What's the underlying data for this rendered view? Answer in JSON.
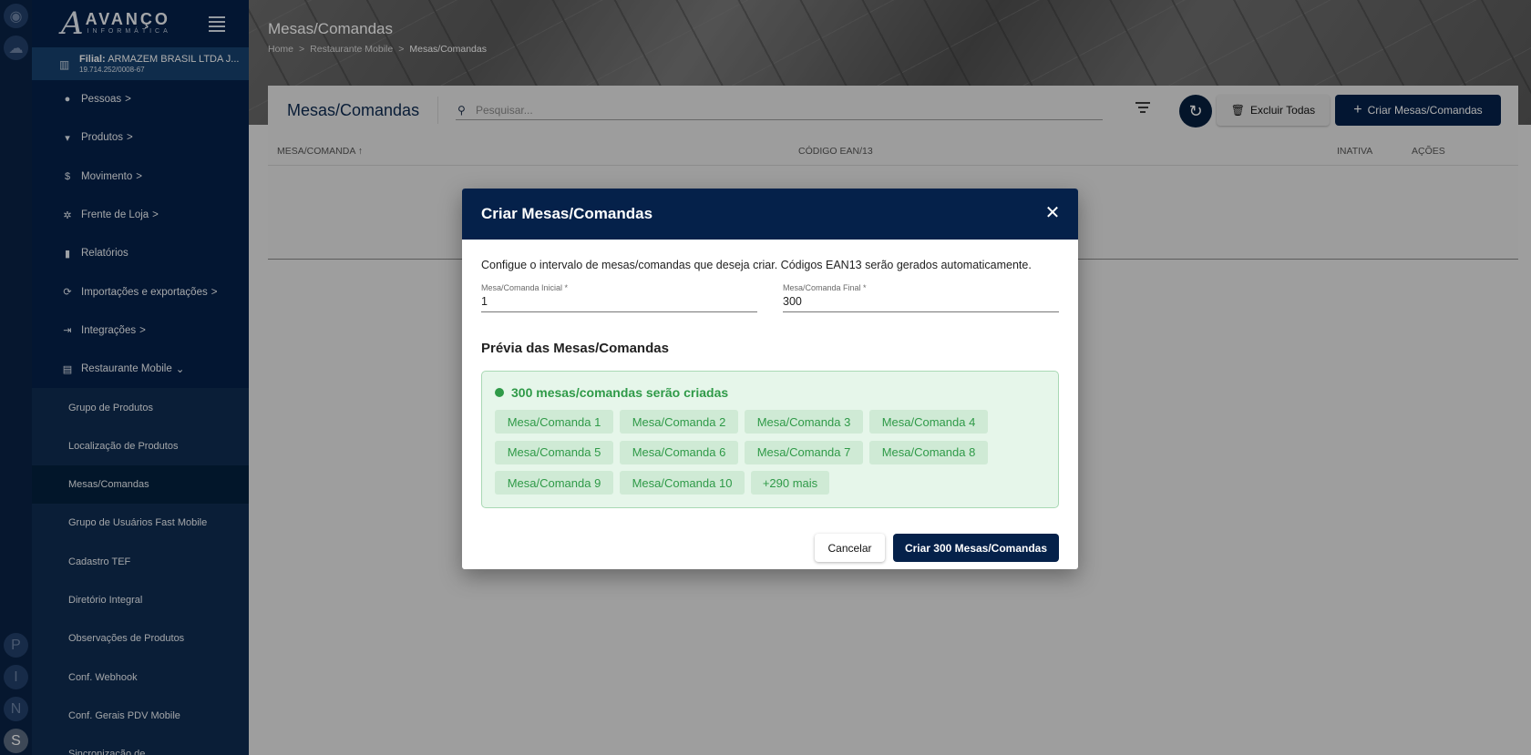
{
  "rail": {
    "top_icons": [
      "user-circle-icon",
      "cloud-icon"
    ],
    "letters": [
      "P",
      "I",
      "N",
      "S"
    ]
  },
  "sidebar": {
    "logo": {
      "word": "AVANÇO",
      "sub": "INFORMÁTICA"
    },
    "filial": {
      "label": "Filial:",
      "name": "ARMAZEM BRASIL LTDA J...",
      "cnpj": "19.714.252/0008-67"
    },
    "items": [
      {
        "label": "Pessoas",
        "icon": "person-icon",
        "suffix": ">"
      },
      {
        "label": "Produtos",
        "icon": "basket-icon",
        "suffix": ">"
      },
      {
        "label": "Movimento",
        "icon": "dollar-icon",
        "suffix": ">"
      },
      {
        "label": "Frente de Loja",
        "icon": "gear-icon",
        "suffix": ">"
      },
      {
        "label": "Relatórios",
        "icon": "bar-chart-icon",
        "suffix": ""
      },
      {
        "label": "Importações e exportações",
        "icon": "sync-icon",
        "suffix": ">"
      },
      {
        "label": "Integrações",
        "icon": "login-icon",
        "suffix": ">"
      },
      {
        "label": "Restaurante Mobile",
        "icon": "store-icon",
        "suffix": "⌄"
      }
    ],
    "subitems": [
      {
        "label": "Grupo de Produtos"
      },
      {
        "label": "Localização de Produtos"
      },
      {
        "label": "Mesas/Comandas",
        "active": true
      },
      {
        "label": "Grupo de Usuários Fast Mobile"
      },
      {
        "label": "Cadastro TEF"
      },
      {
        "label": "Diretório Integral"
      },
      {
        "label": "Observações de Produtos"
      },
      {
        "label": "Conf. Webhook"
      },
      {
        "label": "Conf. Gerais PDV Mobile"
      },
      {
        "label": "Sincronização de"
      }
    ]
  },
  "header": {
    "title": "Mesas/Comandas",
    "breadcrumb": [
      "Home",
      "Restaurante Mobile",
      "Mesas/Comandas"
    ],
    "breadcrumb_sep": ">"
  },
  "toolbar": {
    "title": "Mesas/Comandas",
    "search_placeholder": "Pesquisar...",
    "delete_all_label": "Excluir Todas",
    "create_label": "Criar Mesas/Comandas"
  },
  "table": {
    "columns": [
      "MESA/COMANDA",
      "CÓDIGO EAN/13",
      "INATIVA",
      "AÇÕES"
    ]
  },
  "dialog": {
    "title": "Criar Mesas/Comandas",
    "description": "Configue o intervalo de mesas/comandas que deseja criar. Códigos EAN13 serão gerados automaticamente.",
    "start_label": "Mesa/Comanda Inicial *",
    "start_value": "1",
    "end_label": "Mesa/Comanda Final *",
    "end_value": "300",
    "preview_title": "Prévia das Mesas/Comandas",
    "count_text": "300 mesas/comandas serão criadas",
    "chips": [
      "Mesa/Comanda 1",
      "Mesa/Comanda 2",
      "Mesa/Comanda 3",
      "Mesa/Comanda 4",
      "Mesa/Comanda 5",
      "Mesa/Comanda 6",
      "Mesa/Comanda 7",
      "Mesa/Comanda 8",
      "Mesa/Comanda 9",
      "Mesa/Comanda 10",
      "+290 mais"
    ],
    "cancel_label": "Cancelar",
    "submit_label": "Criar 300 Mesas/Comandas",
    "colors": {
      "header": "#05214a",
      "success": "#2f9a48",
      "success_bg": "#e6f6ea"
    }
  }
}
